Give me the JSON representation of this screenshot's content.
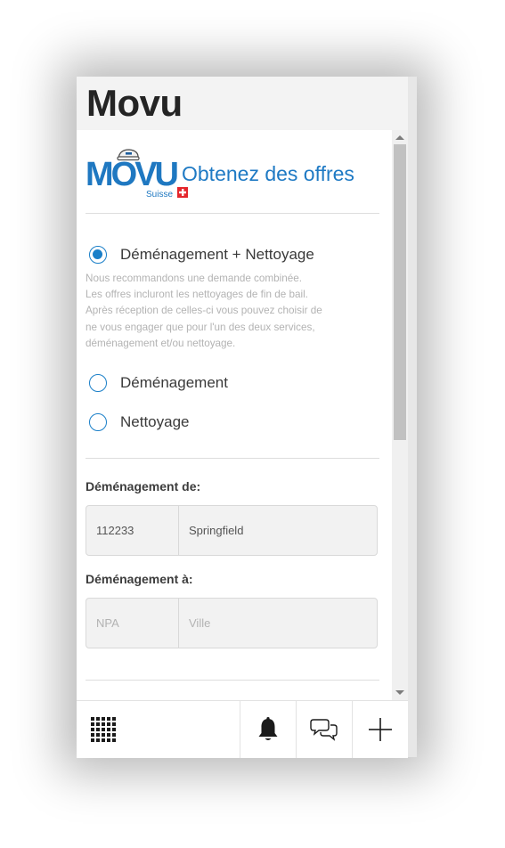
{
  "window": {
    "title": "Movu"
  },
  "logo": {
    "brand": "MOVU",
    "subtitle": "Suisse"
  },
  "header": {
    "headline": "Obtenez des offres"
  },
  "options": [
    {
      "label": "Déménagement + Nettoyage",
      "checked": true
    },
    {
      "label": "Déménagement",
      "checked": false
    },
    {
      "label": "Nettoyage",
      "checked": false
    }
  ],
  "hint": {
    "lines": [
      "Nous recommandons une demande combinée.",
      "Les offres incluront les nettoyages de fin de bail.",
      "Après réception de celles-ci vous pouvez choisir de",
      "ne vous engager que pour l'un des deux services,",
      "déménagement et/ou nettoyage."
    ]
  },
  "from": {
    "label": "Déménagement de:",
    "npa_value": "112233",
    "city_value": "Springfield"
  },
  "to": {
    "label": "Déménagement à:",
    "npa_placeholder": "NPA",
    "city_placeholder": "Ville"
  },
  "colors": {
    "accent": "#1a7fc8",
    "brand": "#1f7ac4",
    "swiss_red": "#e4262c"
  },
  "toolbar": {
    "icons": [
      "apps-grid-icon",
      "bell-icon",
      "chat-icon",
      "plus-icon"
    ]
  }
}
